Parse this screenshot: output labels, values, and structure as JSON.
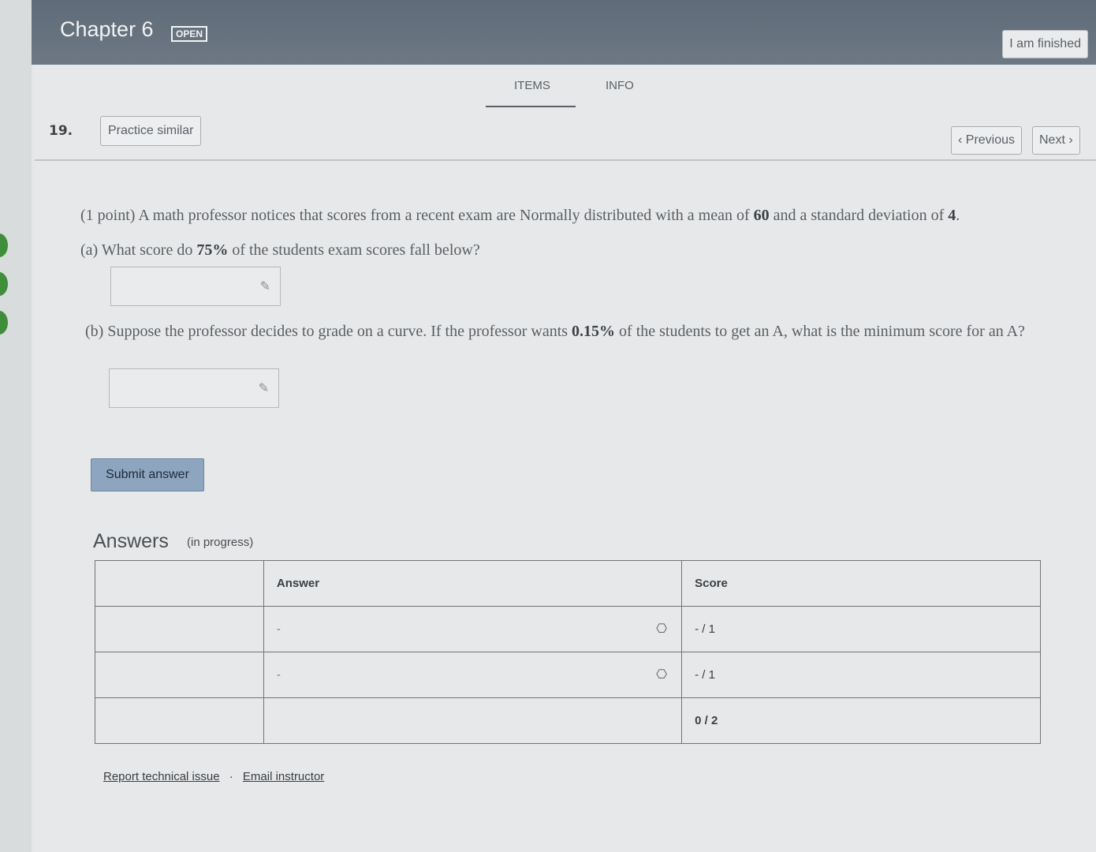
{
  "header": {
    "chapter_title": "Chapter 6",
    "status_badge": "OPEN",
    "finished_label": "I am finished"
  },
  "tabs": [
    {
      "label": "ITEMS",
      "active": true
    },
    {
      "label": "INFO",
      "active": false
    }
  ],
  "question": {
    "number": "19.",
    "practice_label": "Practice similar",
    "prev_label": "Previous",
    "next_label": "Next",
    "intro_pre": "(1 point) A math professor notices that scores from a recent exam are Normally distributed with a mean of ",
    "mean": "60",
    "intro_mid": " and a standard deviation of ",
    "sd": "4",
    "intro_end": ".",
    "part_a_pre": "(a) What score do ",
    "part_a_pct": "75%",
    "part_a_post": " of the students exam scores fall below?",
    "part_b_pre": "(b) Suppose the professor decides to grade on a curve. If the professor wants ",
    "part_b_pct": "0.15%",
    "part_b_post": " of the students to get an A, what is the minimum score for an A?",
    "answer_a_value": "",
    "answer_b_value": "",
    "submit_label": "Submit answer"
  },
  "answers": {
    "heading": "Answers",
    "subheading": "(in progress)",
    "columns": [
      "",
      "Answer",
      "Score"
    ],
    "rows": [
      {
        "answer": "-",
        "score": "- / 1"
      },
      {
        "answer": "-",
        "score": "- / 1"
      }
    ],
    "total_score": "0 / 2"
  },
  "footer": {
    "report_label": "Report technical issue",
    "separator": "·",
    "email_label": "Email instructor"
  }
}
